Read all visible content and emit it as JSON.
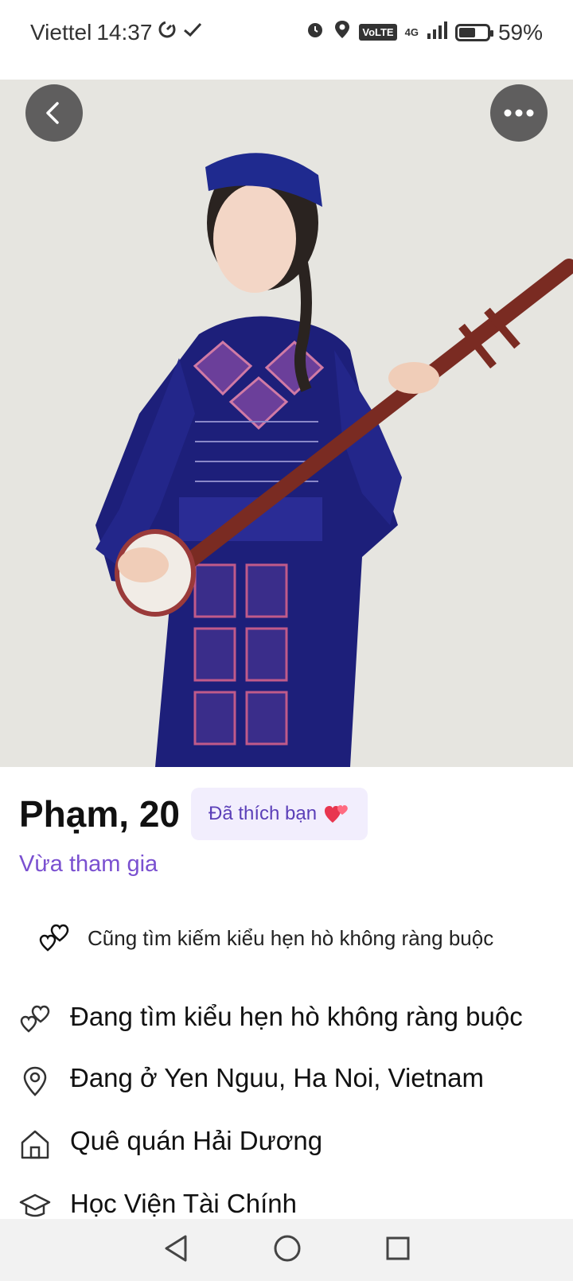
{
  "status_bar": {
    "carrier": "Viettel",
    "time": "14:37",
    "volte": "VoLTE",
    "network": "4G",
    "battery_percent": "59%",
    "battery_level": 0.59
  },
  "profile": {
    "name_age": "Phạm, 20",
    "liked_badge": "Đã thích bạn",
    "joined_status": "Vừa tham gia",
    "also_looking": "Cũng tìm kiếm kiểu hẹn hò không ràng buộc"
  },
  "info_items": [
    {
      "icon": "hearts-icon",
      "text": "Đang tìm kiểu hẹn hò không ràng buộc"
    },
    {
      "icon": "location-pin-icon",
      "text": "Đang ở Yen Nguu, Ha Noi, Vietnam"
    },
    {
      "icon": "home-icon",
      "text": "Quê quán Hải Dương"
    },
    {
      "icon": "school-icon",
      "text": "Học Viện Tài Chính"
    }
  ],
  "colors": {
    "accent": "#7a50d0",
    "badge_bg": "#f2eefd",
    "heart": "#e8364f"
  }
}
